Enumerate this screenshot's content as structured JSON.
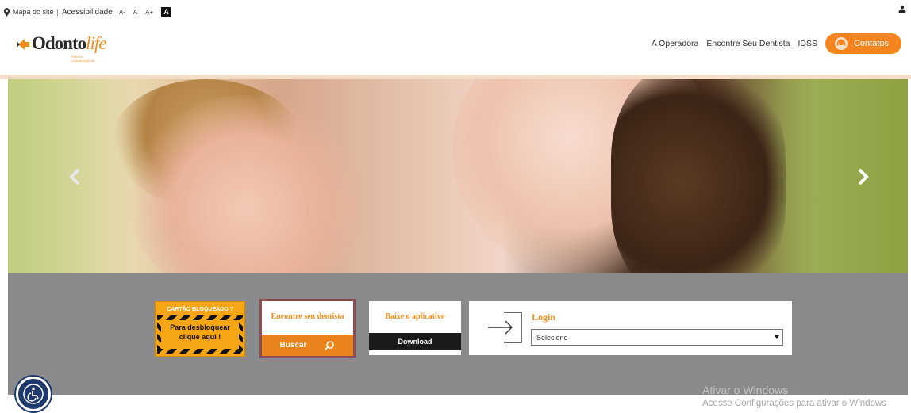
{
  "topbar": {
    "sitemap": "Mapa do site",
    "separator": "|",
    "accessibility": "Acessibilidade",
    "font_smaller": "A-",
    "font_normal": "A",
    "font_larger": "A+",
    "contrast": "A"
  },
  "logo": {
    "brand_main": "Odonto",
    "brand_accent": "life",
    "tagline": "Planos Odontológicos"
  },
  "nav": {
    "items": [
      "A Operadora",
      "Encontre Seu Dentista",
      "IDSS"
    ],
    "contact_label": "Contatos"
  },
  "cards": {
    "blocked": {
      "title": "CARTÃO BLOQUEADO ?",
      "line1": "Para desbloquear",
      "line2": "clique aqui !"
    },
    "dentist": {
      "title": "Encontre seu dentista",
      "button": "Buscar"
    },
    "app": {
      "title": "Baixe o aplicativo",
      "button": "Download"
    },
    "login": {
      "title": "Login",
      "select_value": "Selecione"
    }
  },
  "watermark": {
    "line1": "Ativar o Windows",
    "line2": "Acesse Configurações para ativar o Windows"
  },
  "colors": {
    "brand_orange": "#f5841f",
    "band_grey": "#898a8c",
    "accessibility_blue": "#1e3a6d"
  }
}
